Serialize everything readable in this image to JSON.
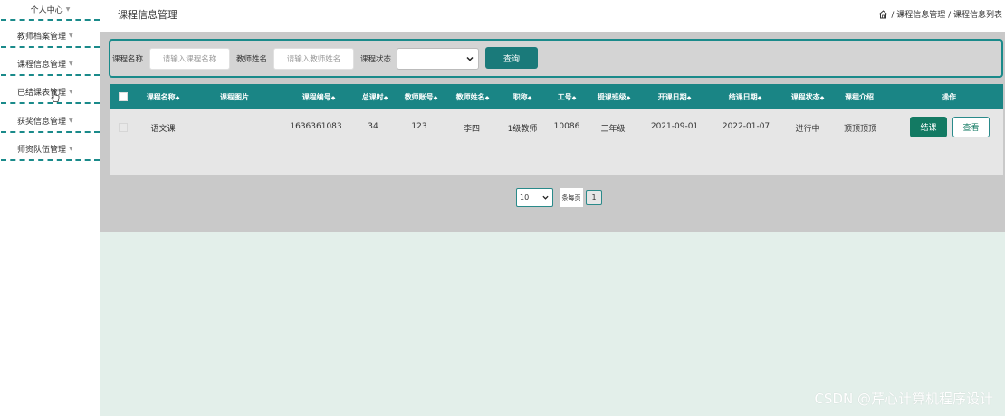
{
  "sidebar": {
    "items": [
      {
        "label": "个人中心"
      },
      {
        "label": "教师档案管理"
      },
      {
        "label": "课程信息管理"
      },
      {
        "label": "已结课表管理"
      },
      {
        "label": "获奖信息管理"
      },
      {
        "label": "师资队伍管理"
      }
    ],
    "caret_icon": "caret-down-icon"
  },
  "header": {
    "title": "课程信息管理",
    "breadcrumb": "/ 课程信息管理 / 课程信息列表"
  },
  "search": {
    "course_name_label": "课程名称",
    "course_name_placeholder": "请输入课程名称",
    "teacher_name_label": "教师姓名",
    "teacher_name_placeholder": "请输入教师姓名",
    "status_label": "课程状态",
    "status_value": "",
    "query_label": "查询"
  },
  "table": {
    "columns": [
      "课程名称",
      "课程图片",
      "课程编号",
      "总课时",
      "教师账号",
      "教师姓名",
      "职称",
      "工号",
      "授课班级",
      "开课日期",
      "结课日期",
      "课程状态",
      "课程介绍",
      "操作"
    ],
    "sort_icon": "sort-arrows-icon",
    "rows": [
      {
        "course_name": "语文课",
        "course_image": "",
        "course_no": "1636361083",
        "total_hours": "34",
        "teacher_account": "123",
        "teacher_name": "李四",
        "title": "1级教师",
        "staff_no": "10086",
        "class": "三年级",
        "start_date": "2021-09-01",
        "end_date": "2022-01-07",
        "status": "进行中",
        "intro": "顶顶顶顶",
        "action_end": "结课",
        "action_view": "查看"
      }
    ]
  },
  "pagination": {
    "page_size": "10",
    "per_page_label": "条每页",
    "current_page": "1"
  },
  "watermark": "CSDN @芹心计算机程序设计",
  "colors": {
    "accent": "#1a8585",
    "dashed_border": "#1a8a8a",
    "end_button": "#137a63",
    "gray_bg": "#c9c9c9",
    "mint_bg": "#e3efea"
  }
}
